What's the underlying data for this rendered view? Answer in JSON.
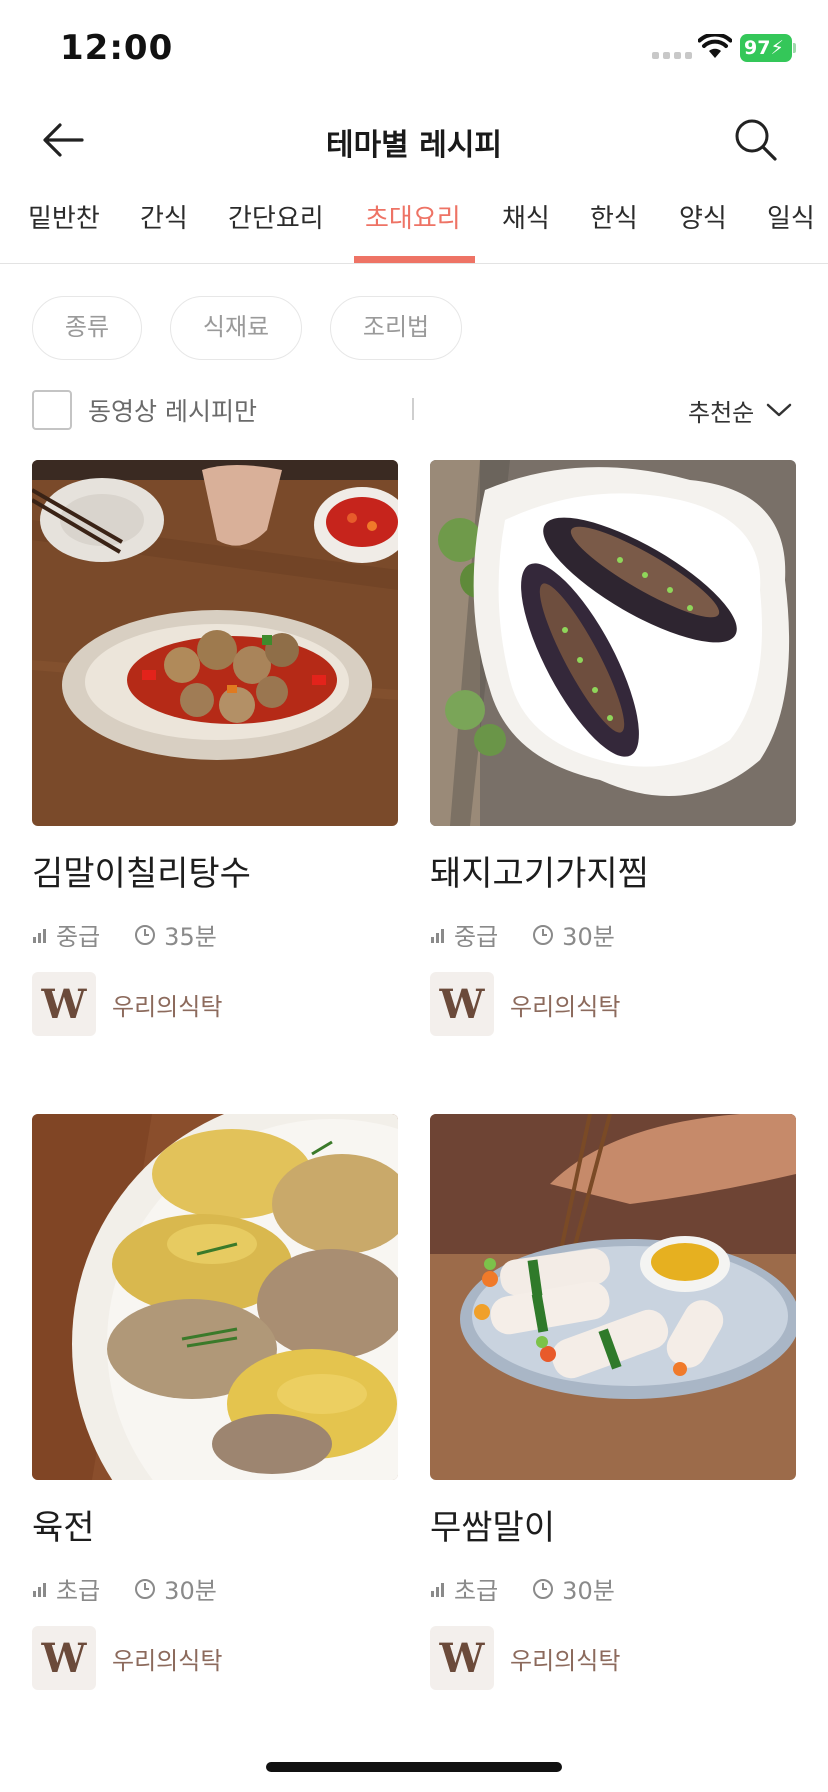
{
  "status_bar": {
    "time": "12:00",
    "battery": "97"
  },
  "nav": {
    "title": "테마별 레시피",
    "back_icon": "arrow-left-icon",
    "search_icon": "search-icon"
  },
  "tabs": [
    {
      "label": "밑반찬",
      "active": false
    },
    {
      "label": "간식",
      "active": false
    },
    {
      "label": "간단요리",
      "active": false
    },
    {
      "label": "초대요리",
      "active": true
    },
    {
      "label": "채식",
      "active": false
    },
    {
      "label": "한식",
      "active": false
    },
    {
      "label": "양식",
      "active": false
    },
    {
      "label": "일식",
      "active": false
    }
  ],
  "filters": [
    "종류",
    "식재료",
    "조리법"
  ],
  "options": {
    "video_only_label": "동영상 레시피만",
    "video_only_checked": false,
    "sort_label": "추천순"
  },
  "recipes": [
    {
      "title": "김말이칠리탕수",
      "level": "중급",
      "time": "35분",
      "author": "우리의식탁",
      "image": "chili-sweet-sour-dish-photo"
    },
    {
      "title": "돼지고기가지찜",
      "level": "중급",
      "time": "30분",
      "author": "우리의식탁",
      "image": "stuffed-eggplant-photo"
    },
    {
      "title": "육전",
      "level": "초급",
      "time": "30분",
      "author": "우리의식탁",
      "image": "beef-pancake-photo"
    },
    {
      "title": "무쌈말이",
      "level": "초급",
      "time": "30분",
      "author": "우리의식탁",
      "image": "radish-wrap-roll-photo"
    }
  ],
  "author_logo_letter": "W",
  "colors": {
    "accent": "#ee7365",
    "author_text": "#8c6a5c",
    "battery": "#34c759"
  }
}
